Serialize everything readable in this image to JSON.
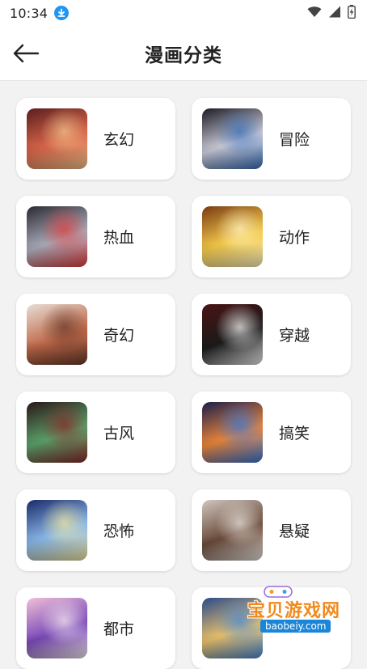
{
  "status": {
    "time": "10:34",
    "icons": [
      "download-icon",
      "wifi-icon",
      "signal-icon",
      "battery-icon"
    ]
  },
  "header": {
    "title": "漫画分类",
    "back_icon": "arrow-left-icon"
  },
  "categories": [
    {
      "label": "玄幻",
      "colors": [
        "#5a1e1e",
        "#d9654a",
        "#f2c38a"
      ]
    },
    {
      "label": "冒险",
      "colors": [
        "#1b1b24",
        "#c9c9d6",
        "#3a6fb8"
      ]
    },
    {
      "label": "热血",
      "colors": [
        "#2a2a33",
        "#a8aab8",
        "#e04040"
      ]
    },
    {
      "label": "动作",
      "colors": [
        "#7a3a12",
        "#f2c84a",
        "#fff3c0"
      ]
    },
    {
      "label": "奇幻",
      "colors": [
        "#e7ded6",
        "#c06a4a",
        "#6a3a2a"
      ]
    },
    {
      "label": "穿越",
      "colors": [
        "#4a1414",
        "#1a1a1a",
        "#f0f0f0"
      ]
    },
    {
      "label": "古风",
      "colors": [
        "#2a1616",
        "#5aa06a",
        "#8a2a2a"
      ]
    },
    {
      "label": "搞笑",
      "colors": [
        "#1a1e4a",
        "#e8843a",
        "#3a78d8"
      ]
    },
    {
      "label": "恐怖",
      "colors": [
        "#1a2a6a",
        "#8ab8e8",
        "#f0e6a0"
      ]
    },
    {
      "label": "悬疑",
      "colors": [
        "#cfc6be",
        "#6a4a3a",
        "#e8e2dc"
      ]
    },
    {
      "label": "都市",
      "colors": [
        "#f0c0d8",
        "#7a4ab8",
        "#f5e8f0"
      ]
    },
    {
      "label": "",
      "colors": [
        "#2a4a8a",
        "#e8c06a",
        "#4a8ad8"
      ]
    }
  ],
  "watermark": {
    "text": "宝贝游戏网",
    "url": "baobeiy.com"
  }
}
